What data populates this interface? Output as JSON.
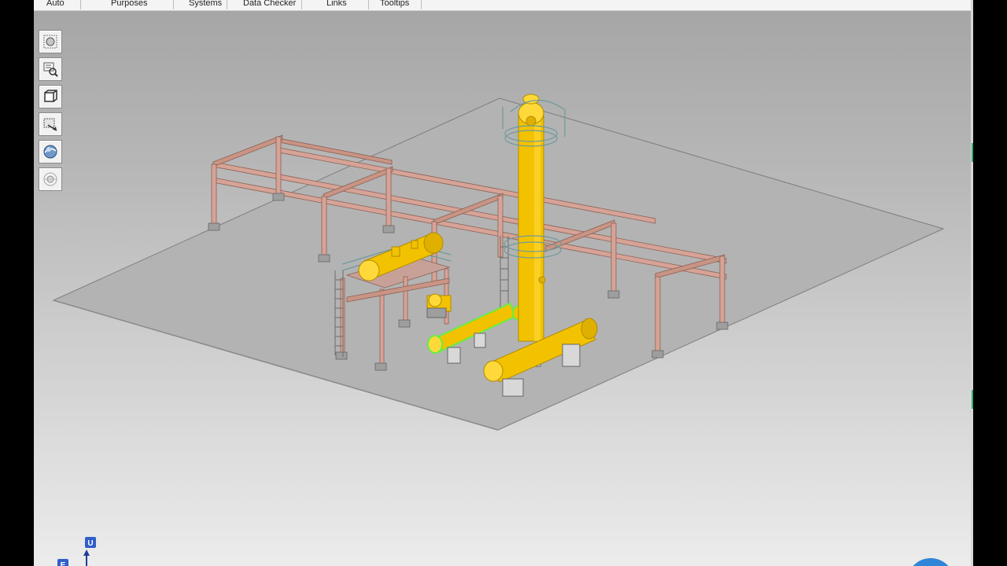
{
  "menu": {
    "items": [
      "Auto",
      "Purposes",
      "Systems",
      "Data Checker",
      "Links",
      "Tooltips"
    ]
  },
  "toolbar": {
    "tools": [
      "fit-all-icon",
      "zoom-area-icon",
      "normal-view-icon",
      "pan-icon",
      "rotate-icon",
      "fly-mode-icon"
    ]
  },
  "axis": {
    "up_label": "U",
    "east_label": "E"
  },
  "colors": {
    "equipment": "#f2c200",
    "selected": "#66ee44",
    "structure": "#d6a396",
    "slab": "#b3b3b3",
    "handrail": "#6e9a9a",
    "accent": "#2f86d6"
  }
}
